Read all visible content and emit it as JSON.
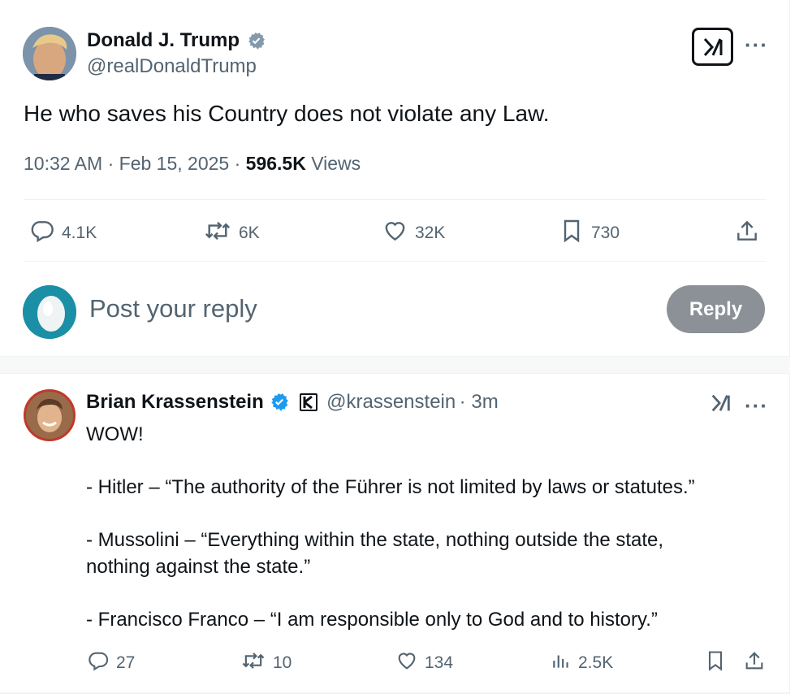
{
  "main_post": {
    "author_name": "Donald J. Trump",
    "author_handle": "@realDonaldTrump",
    "text": "He who saves his Country does not violate any Law.",
    "time": "10:32 AM",
    "date": "Feb 15, 2025",
    "views_count": "596.5K",
    "views_label": "Views",
    "actions": {
      "replies": "4.1K",
      "reposts": "6K",
      "likes": "32K",
      "bookmarks": "730"
    }
  },
  "composer": {
    "placeholder": "Post your reply",
    "reply_button": "Reply"
  },
  "reply_post": {
    "author_name": "Brian Krassenstein",
    "author_handle": "@krassenstein",
    "time_ago": "3m",
    "lines": [
      "WOW!",
      "",
      "- Hitler – “The authority of the Führer is not limited by laws or statutes.”",
      "",
      "- Mussolini – “Everything within the state, nothing outside the state,",
      "nothing against the state.”",
      "",
      "- Francisco Franco – “I am responsible only to God and to history.”"
    ],
    "actions": {
      "replies": "27",
      "reposts": "10",
      "likes": "134",
      "views": "2.5K"
    }
  },
  "colors": {
    "text_primary": "#0f1419",
    "text_secondary": "#536471",
    "verified_blue": "#1d9bf0",
    "verified_gray": "#829aab",
    "reply_button_bg": "#8b9196"
  },
  "icons": [
    "verified-badge-icon",
    "grok-icon",
    "more-icon",
    "reply-icon",
    "repost-icon",
    "like-icon",
    "bookmark-icon",
    "share-icon",
    "views-icon"
  ]
}
